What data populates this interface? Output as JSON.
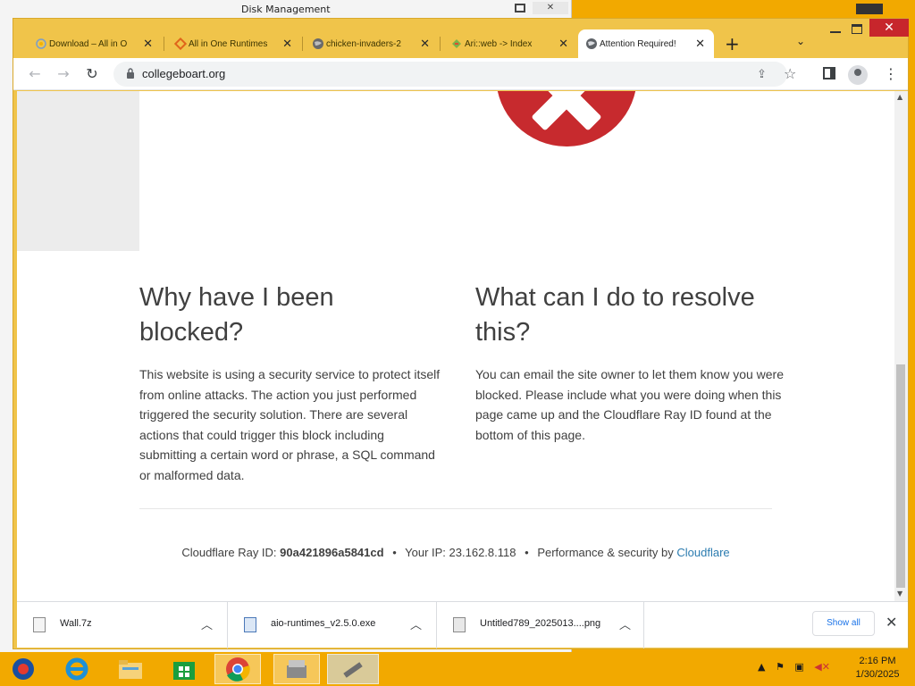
{
  "background_window": {
    "title": "Disk Management"
  },
  "tabs": [
    {
      "label": "Download – All in O",
      "close": "✕"
    },
    {
      "label": "All in One Runtimes",
      "close": "✕"
    },
    {
      "label": "chicken-invaders-2",
      "close": "✕"
    },
    {
      "label": "Ari::web -> Index",
      "close": "✕"
    },
    {
      "label": "Attention Required!",
      "close": "✕"
    }
  ],
  "toolbar": {
    "new_tab": "+",
    "url": "collegeboart.org"
  },
  "page": {
    "left_heading": "Why have I been blocked?",
    "left_body": "This website is using a security service to protect itself from online attacks. The action you just performed triggered the security solution. There are several actions that could trigger this block including submitting a certain word or phrase, a SQL command or malformed data.",
    "right_heading": "What can I do to resolve this?",
    "right_body": "You can email the site owner to let them know you were blocked. Please include what you were doing when this page came up and the Cloudflare Ray ID found at the bottom of this page.",
    "footer": {
      "ray_label": "Cloudflare Ray ID:",
      "ray_id": "90a421896a5841cd",
      "ip_label": "Your IP:",
      "ip": "23.162.8.118",
      "perf_label": "Performance & security by",
      "cloudflare_link": "Cloudflare",
      "bullet": "•"
    }
  },
  "downloads": {
    "items": [
      {
        "name": "Wall.7z"
      },
      {
        "name": "aio-runtimes_v2.5.0.exe"
      },
      {
        "name": "Untitled789_2025013....png"
      }
    ],
    "show_all": "Show all"
  },
  "taskbar": {
    "time": "2:16 PM",
    "date": "1/30/2025"
  },
  "colors": {
    "accent": "#f0c44a",
    "error_red": "#c72a2e",
    "link_blue": "#2c7cb0"
  }
}
